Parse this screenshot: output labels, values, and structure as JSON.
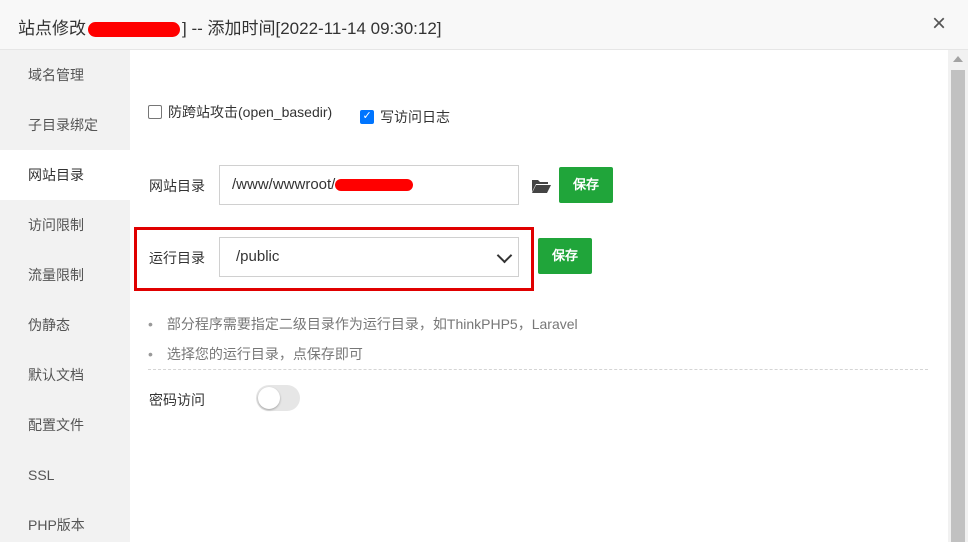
{
  "dialog": {
    "title_prefix": "站点修改",
    "title_suffix": "] -- 添加时间[2022-11-14 09:30:12]",
    "close_label": "×"
  },
  "sidebar": {
    "items": [
      {
        "label": "域名管理"
      },
      {
        "label": "子目录绑定"
      },
      {
        "label": "网站目录"
      },
      {
        "label": "访问限制"
      },
      {
        "label": "流量限制"
      },
      {
        "label": "伪静态"
      },
      {
        "label": "默认文档"
      },
      {
        "label": "配置文件"
      },
      {
        "label": "SSL"
      },
      {
        "label": "PHP版本"
      }
    ],
    "active_item": "网站目录"
  },
  "options": {
    "open_basedir_label": "防跨站攻击(open_basedir)",
    "open_basedir_checked": false,
    "access_log_label": "写访问日志",
    "access_log_checked": true
  },
  "site_dir": {
    "label": "网站目录",
    "value": "/www/wwwroot/",
    "folder_icon": "folder-open-icon",
    "save_label": "保存"
  },
  "run_dir": {
    "label": "运行目录",
    "value": "/public",
    "save_label": "保存"
  },
  "tips": [
    "部分程序需要指定二级目录作为运行目录，如ThinkPHP5，Laravel",
    "选择您的运行目录，点保存即可"
  ],
  "password_access": {
    "label": "密码访问",
    "enabled": false
  },
  "colors": {
    "accent_green": "#20a53a",
    "highlight_red": "#e00000",
    "checkbox_blue": "#0075ff"
  }
}
